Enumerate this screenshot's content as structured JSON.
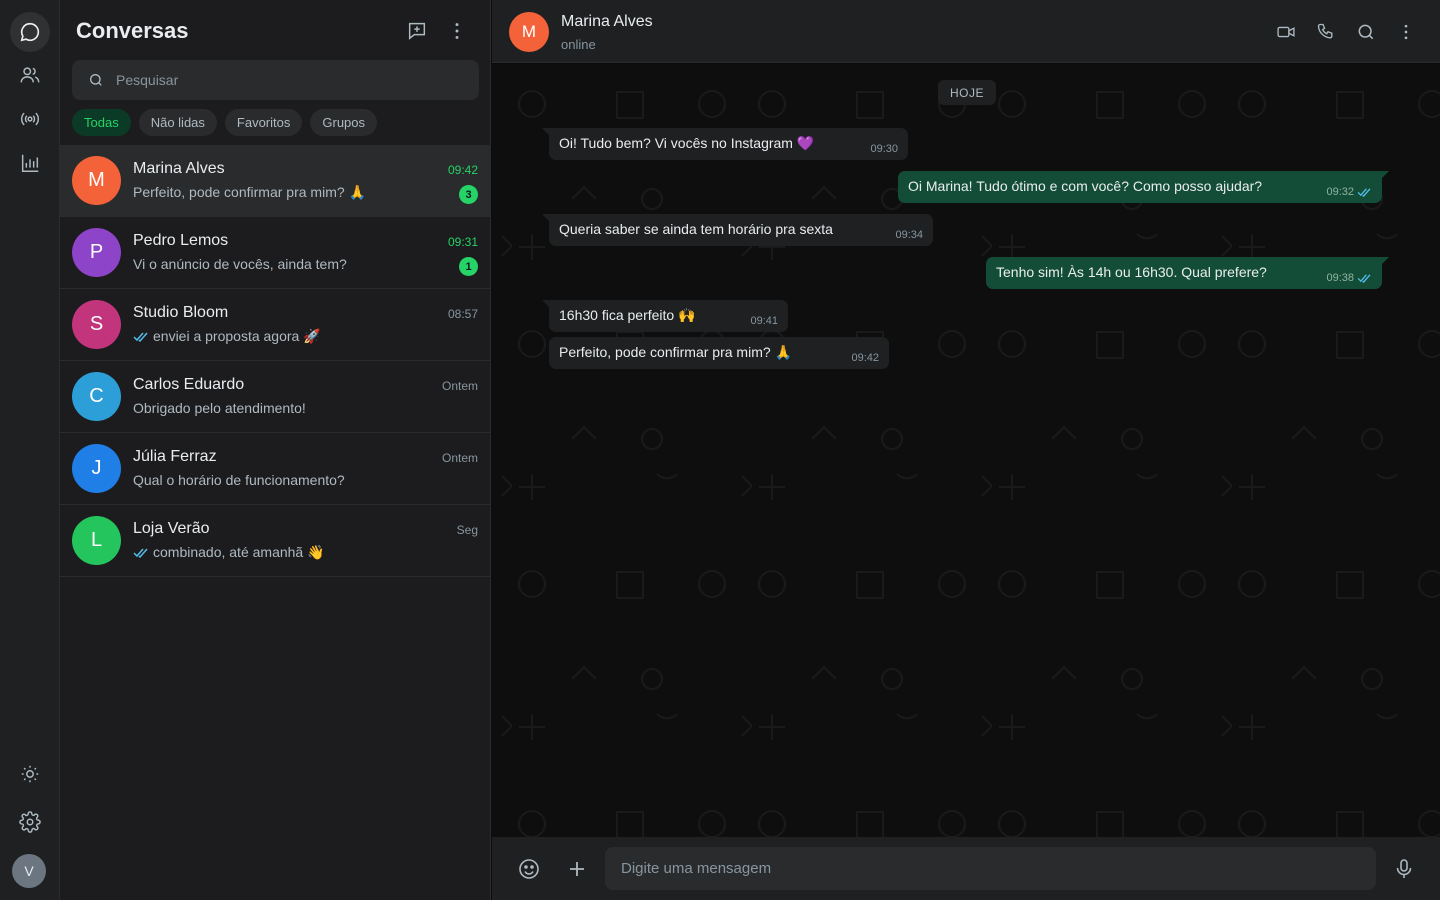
{
  "colors": {
    "accent": "#25d366",
    "outgoing_bubble": "#144d37",
    "incoming_bubble": "#1f2022",
    "read_ticks": "#53bdeb"
  },
  "rail": {
    "icons": [
      "chat-icon",
      "contacts-icon",
      "broadcast-icon",
      "stats-icon",
      "sun-icon",
      "gear-icon"
    ],
    "avatar_initial": "V"
  },
  "sidebar": {
    "title": "Conversas",
    "search_placeholder": "Pesquisar",
    "filters": [
      "Todas",
      "Não lidas",
      "Favoritos",
      "Grupos"
    ],
    "active_filter": "Todas",
    "chats": [
      {
        "initial": "M",
        "name": "Marina Alves",
        "time": "09:42",
        "preview": "Perfeito, pode confirmar pra mim? 🙏",
        "unread": "3",
        "color": "#f4623a",
        "ticks": false,
        "selected": true
      },
      {
        "initial": "P",
        "name": "Pedro Lemos",
        "time": "09:31",
        "preview": "Vi o anúncio de vocês, ainda tem?",
        "unread": "1",
        "color": "#8e44c9",
        "ticks": false,
        "selected": false
      },
      {
        "initial": "S",
        "name": "Studio Bloom",
        "time": "08:57",
        "preview": "enviei a proposta agora 🚀",
        "unread": "",
        "color": "#c2347c",
        "ticks": true,
        "selected": false
      },
      {
        "initial": "C",
        "name": "Carlos Eduardo",
        "time": "Ontem",
        "preview": "Obrigado pelo atendimento!",
        "unread": "",
        "color": "#2d9fd8",
        "ticks": false,
        "selected": false
      },
      {
        "initial": "J",
        "name": "Júlia Ferraz",
        "time": "Ontem",
        "preview": "Qual o horário de funcionamento?",
        "unread": "",
        "color": "#1f7fe6",
        "ticks": false,
        "selected": false
      },
      {
        "initial": "L",
        "name": "Loja Verão",
        "time": "Seg",
        "preview": "combinado, até amanhã 👋",
        "unread": "",
        "color": "#25c55e",
        "ticks": true,
        "selected": false
      }
    ]
  },
  "header": {
    "initial": "M",
    "name": "Marina Alves",
    "status": "online",
    "icons": [
      "video-call-icon",
      "voice-call-icon",
      "search-icon",
      "more-icon"
    ]
  },
  "conversation": {
    "date_label": "HOJE",
    "messages": [
      {
        "dir": "in",
        "text": "Oi! Tudo bem? Vi vocês no Instagram 💜",
        "time": "09:30",
        "tail": true
      },
      {
        "dir": "out",
        "text": "Oi Marina! Tudo ótimo e com você? Como posso ajudar?",
        "time": "09:32",
        "tail": true
      },
      {
        "dir": "in",
        "text": "Queria saber se ainda tem horário pra sexta",
        "time": "09:34",
        "tail": true
      },
      {
        "dir": "out",
        "text": "Tenho sim! Às 14h ou 16h30. Qual prefere?",
        "time": "09:38",
        "tail": true
      },
      {
        "dir": "in",
        "text": "16h30 fica perfeito 🙌",
        "time": "09:41",
        "tail": true
      },
      {
        "dir": "in",
        "text": "Perfeito, pode confirmar pra mim? 🙏",
        "time": "09:42",
        "tail": false
      }
    ]
  },
  "composer": {
    "placeholder": "Digite uma mensagem",
    "icons": [
      "emoji-icon",
      "attach-plus-icon",
      "microphone-icon"
    ]
  }
}
